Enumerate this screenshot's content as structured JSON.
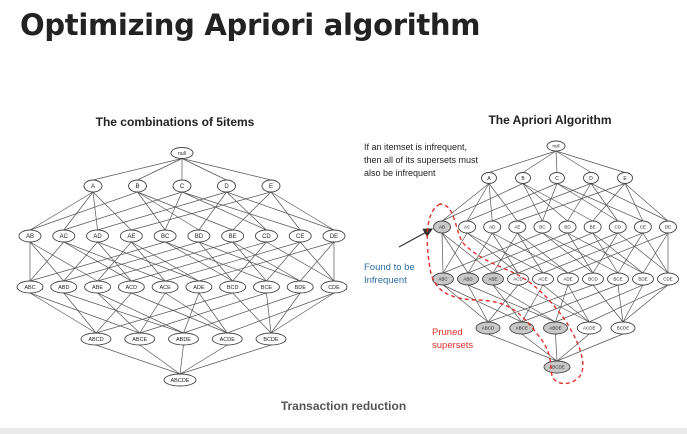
{
  "title": "Optimizing Apriori algorithm",
  "caption": "Transaction reduction",
  "colors": {
    "edge": "#555555",
    "node_stroke": "#444444",
    "pruned_fill": "#c8c8c8",
    "annotation_blue": "#2e6da4",
    "annotation_red": "#e0312b"
  },
  "left_diagram": {
    "heading": "The combinations of 5items",
    "levels": [
      [
        "null"
      ],
      [
        "A",
        "B",
        "C",
        "D",
        "E"
      ],
      [
        "AB",
        "AC",
        "AD",
        "AE",
        "BC",
        "BD",
        "BE",
        "CD",
        "CE",
        "DE"
      ],
      [
        "ABC",
        "ABD",
        "ABE",
        "ACD",
        "ACE",
        "ADE",
        "BCD",
        "BCE",
        "BDE",
        "CDE"
      ],
      [
        "ABCD",
        "ABCE",
        "ABDE",
        "ACDE",
        "BCDE"
      ],
      [
        "ABCDE"
      ]
    ]
  },
  "right_diagram": {
    "heading": "The Apriori Algorithm",
    "note_lines": [
      "If an itemset is infrequent,",
      "then all of its supersets must",
      "also be infrequent"
    ],
    "found_lines": [
      "Found to be",
      "Infrequent"
    ],
    "pruned_lines": [
      "Pruned",
      "supersets"
    ],
    "infrequent_itemset": "AB",
    "pruned_itemsets": [
      "AB",
      "ABC",
      "ABD",
      "ABE",
      "ABCD",
      "ABCE",
      "ABDE",
      "ABCDE"
    ],
    "levels": [
      [
        "null"
      ],
      [
        "A",
        "B",
        "C",
        "D",
        "E"
      ],
      [
        "AB",
        "AC",
        "AD",
        "AE",
        "BC",
        "BD",
        "BE",
        "CD",
        "CE",
        "DE"
      ],
      [
        "ABC",
        "ABD",
        "ABE",
        "ACD",
        "ACE",
        "ADE",
        "BCD",
        "BCE",
        "BDE",
        "CDE"
      ],
      [
        "ABCD",
        "ABCE",
        "ABDE",
        "ACDE",
        "BCDE"
      ],
      [
        "ABCDE"
      ]
    ]
  }
}
